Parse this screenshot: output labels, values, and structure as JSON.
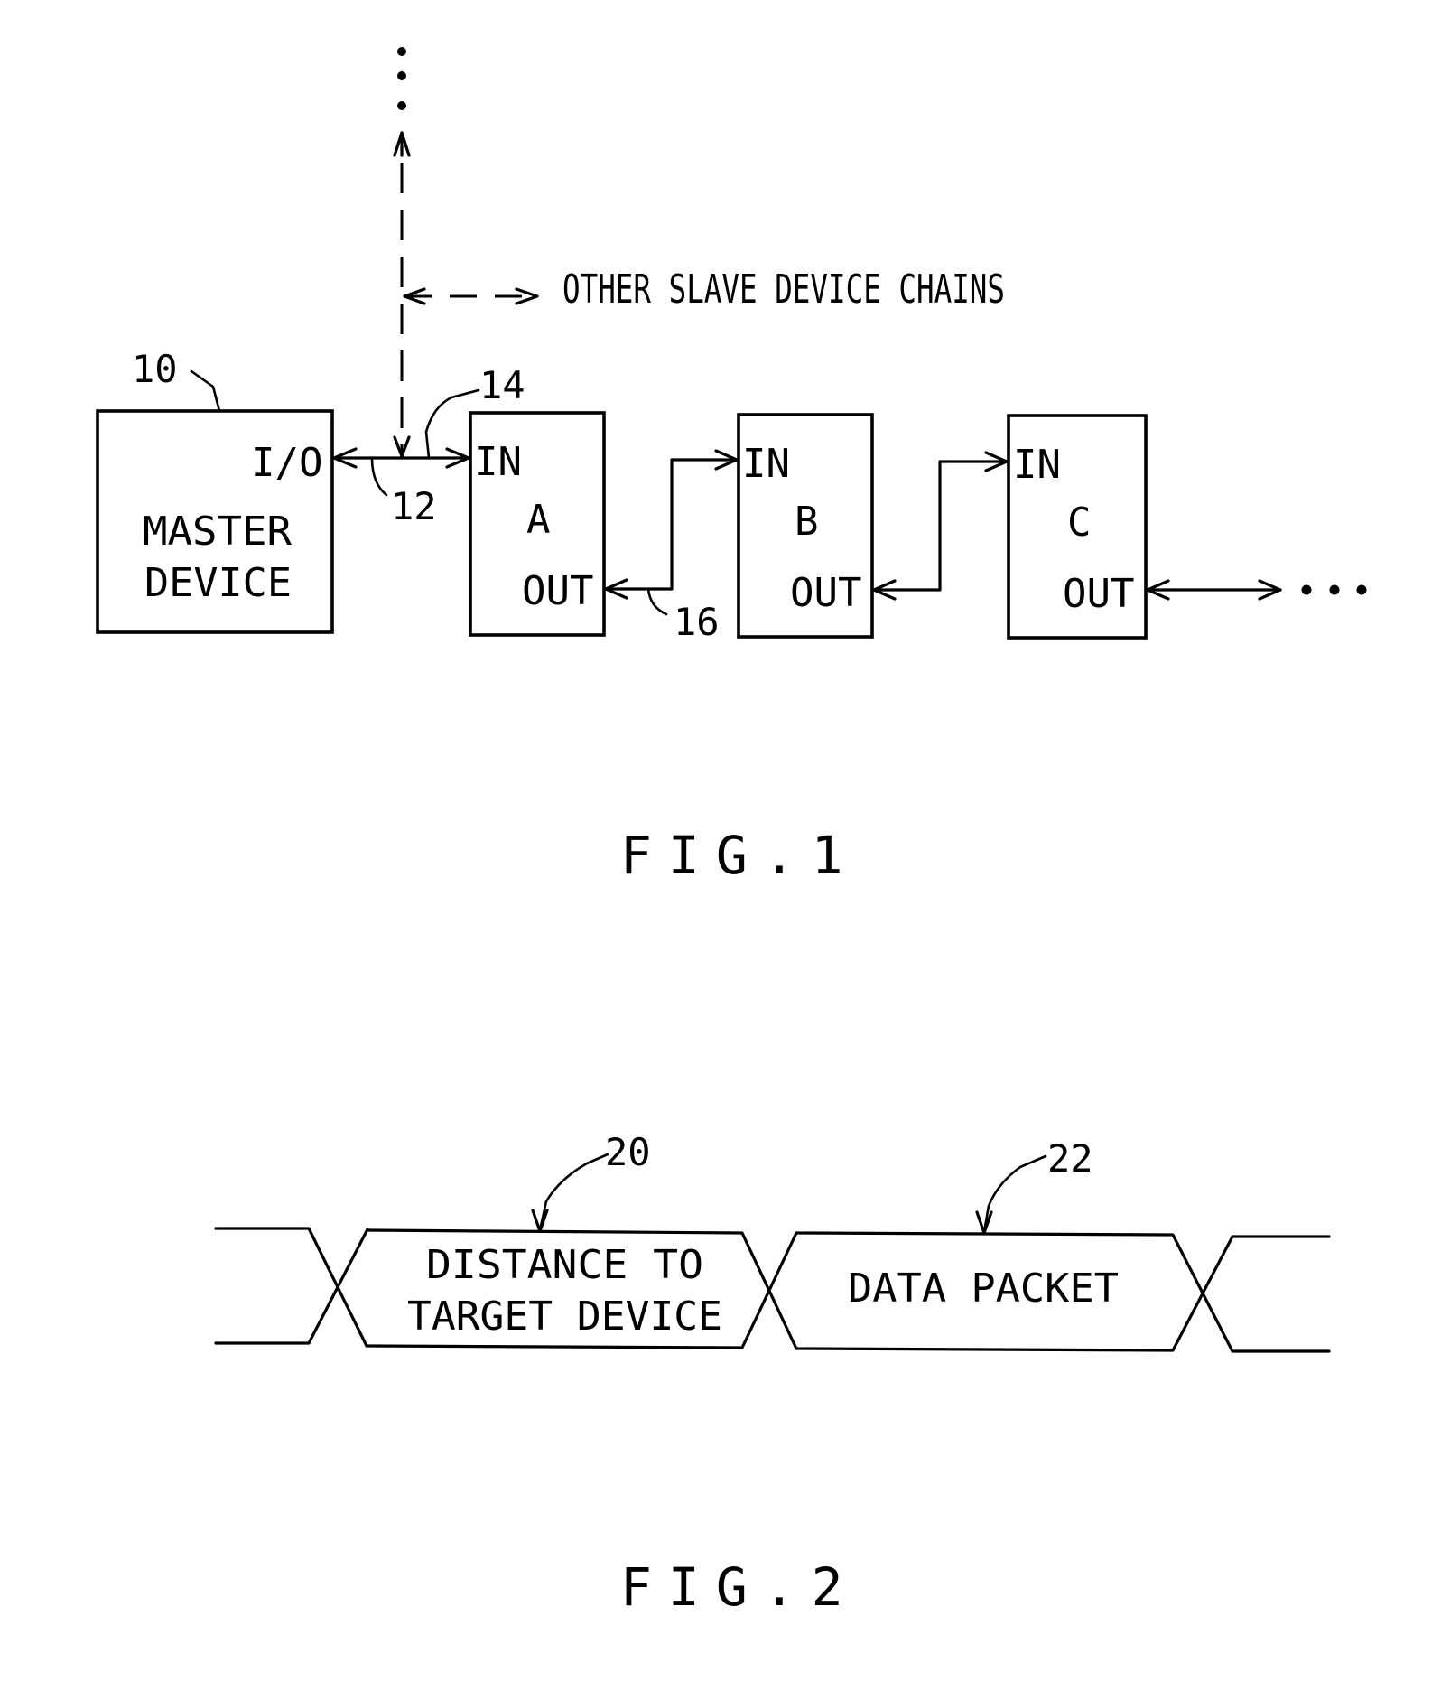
{
  "figure1": {
    "caption": "FIG.1",
    "other_chains_label": "OTHER SLAVE DEVICE CHAINS",
    "master": {
      "ref": "10",
      "port": "I/O",
      "line1": "MASTER",
      "line2": "DEVICE"
    },
    "bus_refs": {
      "bus": "12",
      "branch": "14",
      "link": "16"
    },
    "slaves": [
      {
        "name": "A",
        "in": "IN",
        "out": "OUT"
      },
      {
        "name": "B",
        "in": "IN",
        "out": "OUT"
      },
      {
        "name": "C",
        "in": "IN",
        "out": "OUT"
      }
    ],
    "continuation": "..."
  },
  "figure2": {
    "caption": "FIG.2",
    "fields": [
      {
        "ref": "20",
        "line1": "DISTANCE TO",
        "line2": "TARGET DEVICE"
      },
      {
        "ref": "22",
        "line1": "DATA PACKET"
      }
    ]
  }
}
